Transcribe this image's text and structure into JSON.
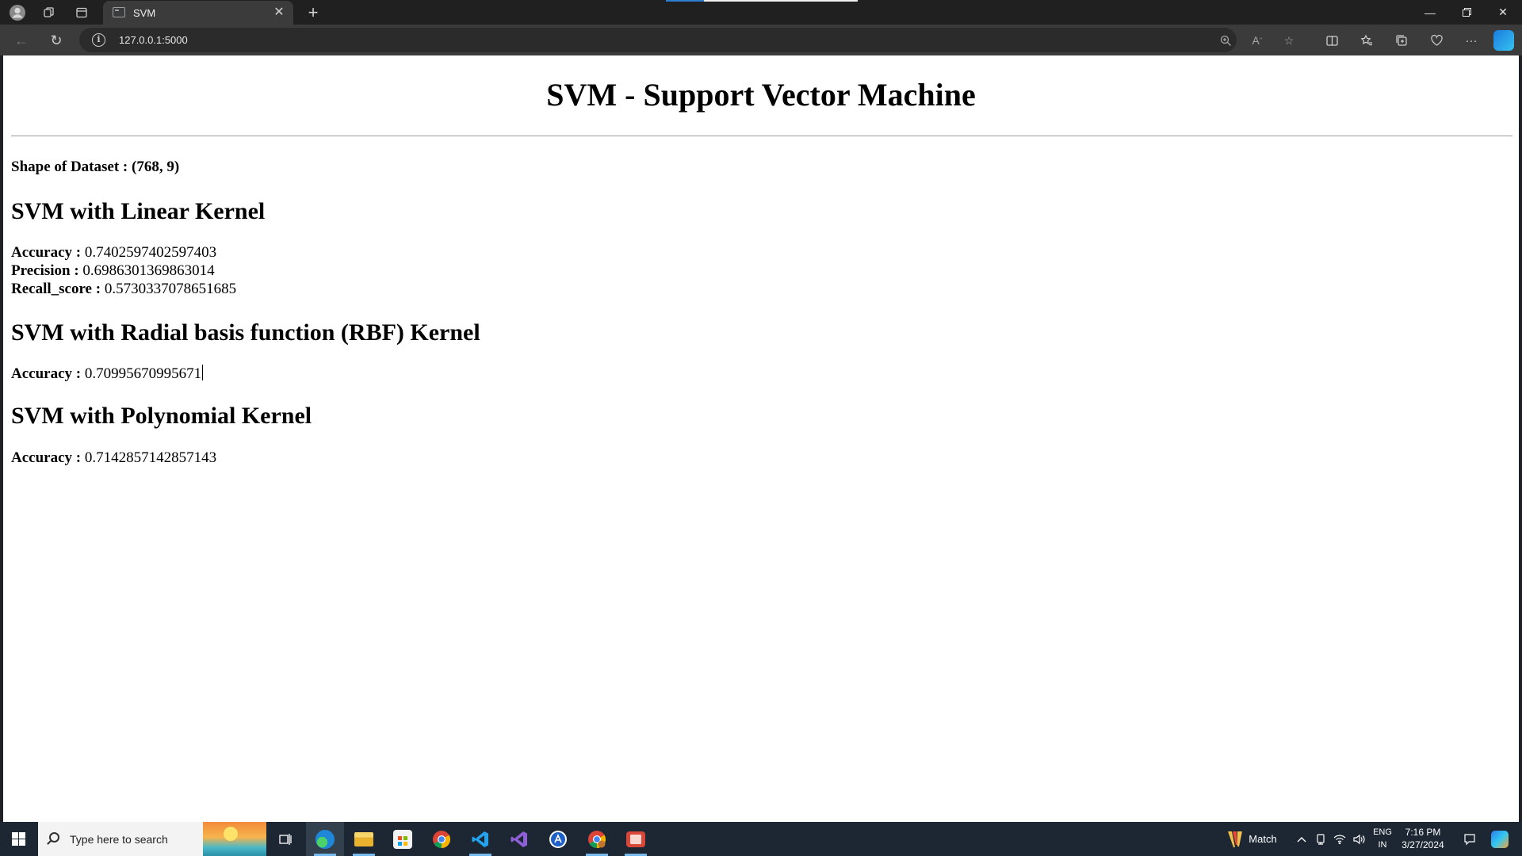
{
  "browser": {
    "tab_title": "SVM",
    "url": "127.0.0.1:5000"
  },
  "page": {
    "title": "SVM - Support Vector Machine",
    "shape_label": "Shape of Dataset : (768, 9)",
    "linear": {
      "heading": "SVM with Linear Kernel",
      "accuracy_label": "Accuracy :",
      "accuracy_value": "0.7402597402597403",
      "precision_label": "Precision :",
      "precision_value": "0.6986301369863014",
      "recall_label": "Recall_score :",
      "recall_value": "0.5730337078651685"
    },
    "rbf": {
      "heading": "SVM with Radial basis function (RBF) Kernel",
      "accuracy_label": "Accuracy :",
      "accuracy_value": "0.70995670995671"
    },
    "poly": {
      "heading": "SVM with Polynomial Kernel",
      "accuracy_label": "Accuracy :",
      "accuracy_value": "0.7142857142857143"
    }
  },
  "taskbar": {
    "search_placeholder": "Type here to search",
    "weather_label": "Match",
    "lang_line1": "ENG",
    "lang_line2": "IN",
    "time": "7:16 PM",
    "date": "3/27/2024"
  }
}
